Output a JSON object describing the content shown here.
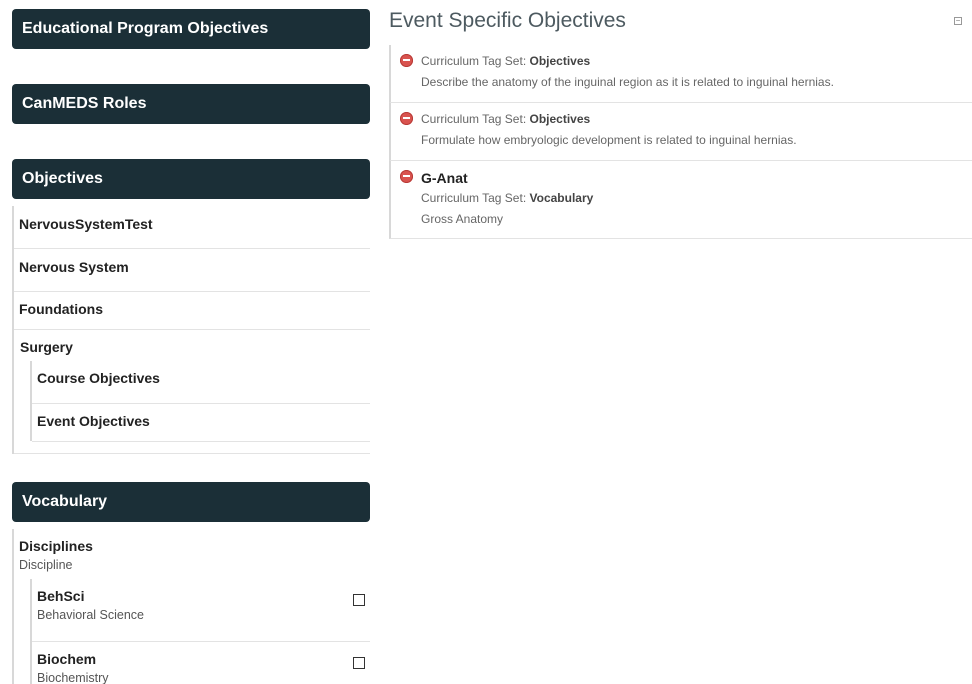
{
  "sidebar": {
    "educational_program_objectives": "Educational Program Objectives",
    "canmeds_roles": "CanMEDS Roles",
    "objectives": {
      "header": "Objectives",
      "items": [
        "NervousSystemTest",
        "Nervous System",
        "Foundations",
        "Surgery"
      ],
      "surgery_children": [
        "Course Objectives",
        "Event Objectives"
      ]
    },
    "vocabulary": {
      "header": "Vocabulary",
      "group_title": "Disciplines",
      "group_subtitle": "Discipline",
      "children": [
        {
          "code": "BehSci",
          "name": "Behavioral Science",
          "checked": false
        },
        {
          "code": "Biochem",
          "name": "Biochemistry",
          "checked": false
        }
      ]
    }
  },
  "main": {
    "title": "Event Specific Objectives",
    "tag_set_prefix": "Curriculum Tag Set:",
    "objectives": [
      {
        "title": "",
        "tag_set": "Objectives",
        "description": "Describe the anatomy of the inguinal region as it is related to inguinal hernias."
      },
      {
        "title": "",
        "tag_set": "Objectives",
        "description": "Formulate how embryologic development is related to inguinal hernias."
      },
      {
        "title": "G-Anat",
        "tag_set": "Vocabulary",
        "description": "Gross Anatomy"
      }
    ]
  },
  "colors": {
    "header_bg": "#1b2f37",
    "remove_icon": "#d9534f"
  }
}
